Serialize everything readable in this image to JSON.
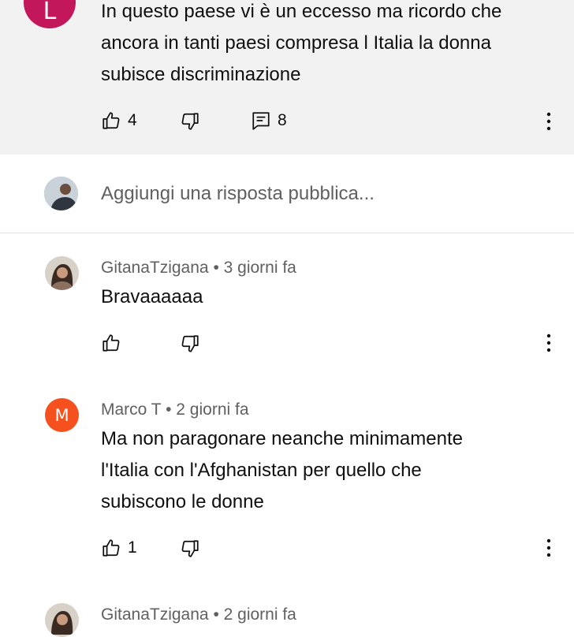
{
  "top_comment": {
    "avatar_letter": "L",
    "avatar_color": "#c2185b",
    "text_lines": [
      "In questo paese vi è un eccesso ma ricordo che",
      "ancora in tanti paesi compresa l Italia la donna",
      "subisce discriminazione"
    ],
    "like_count": "4",
    "reply_count": "8",
    "icons": [
      "thumb-up-icon",
      "thumb-down-icon",
      "replies-icon",
      "more-vert-icon"
    ]
  },
  "reply_box": {
    "placeholder": "Aggiungi una risposta pubblica..."
  },
  "replies": [
    {
      "author": "GitanaTzigana",
      "time": "3 giorni fa",
      "text_lines": [
        "Bravaaaaaa"
      ],
      "like_count": ""
    },
    {
      "author": "Marco T",
      "time": "2 giorni fa",
      "avatar_letter": "M",
      "avatar_color": "#f4511e",
      "text_lines": [
        "Ma non paragonare neanche minimamente",
        "l'Italia con l'Afghanistan per quello che",
        "subiscono le donne"
      ],
      "like_count": "1"
    },
    {
      "author": "GitanaTzigana",
      "time": "2 giorni fa"
    }
  ],
  "separator": "•"
}
